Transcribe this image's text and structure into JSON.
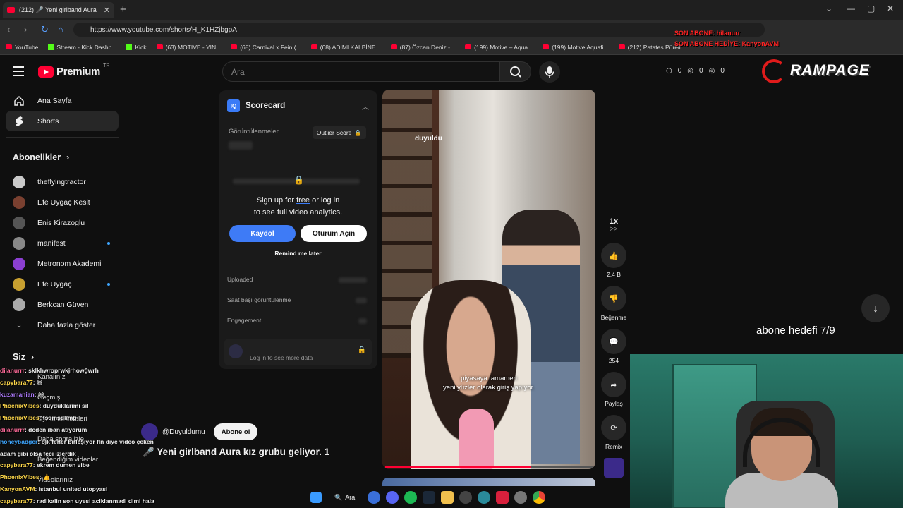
{
  "browser": {
    "tab_title": "(212) 🎤 Yeni girlband Aura",
    "tab_close": "✕",
    "new_tab": "+",
    "url": "https://www.youtube.com/shorts/H_K1HZjbgpA",
    "bookmarks": [
      "YouTube",
      "Stream - Kick Dashb...",
      "Kick",
      "(63) MOTIVE - YIN...",
      "(68) Carnival x Fein (...",
      "(68) ADIMI KALBİNE...",
      "(87) Özcan Deniz -...",
      "(199) Motive – Aqua...",
      "(199) Motive Aquafi...",
      "(212) Patates Püreli..."
    ]
  },
  "overlay": {
    "last_sub_line1": "SON ABONE: hilanurr",
    "last_sub_line2": "SON ABONE HEDİYE: KanyonAVM",
    "brand": "RAMPAGE",
    "sub_goal": "abone hedefi 7/9"
  },
  "header": {
    "logo_text": "Premium",
    "region": "TR",
    "search_placeholder": "Ara",
    "stats": [
      "0",
      "0",
      "0"
    ]
  },
  "sidebar": {
    "main": [
      {
        "label": "Ana Sayfa"
      },
      {
        "label": "Shorts"
      }
    ],
    "subs_title": "Abonelikler",
    "subs": [
      {
        "label": "theflyingtractor",
        "color": "#c9c9c9",
        "dot": false
      },
      {
        "label": "Efe Uygaç Kesit",
        "color": "#7a4030",
        "dot": false
      },
      {
        "label": "Enis Kirazoglu",
        "color": "#555555",
        "dot": false
      },
      {
        "label": "manifest",
        "color": "#888888",
        "dot": true
      },
      {
        "label": "Metronom Akademi",
        "color": "#8b3fd1",
        "dot": false
      },
      {
        "label": "Efe Uygaç",
        "color": "#c8a030",
        "dot": true
      },
      {
        "label": "Berkcan Güven",
        "color": "#aaaaaa",
        "dot": false
      }
    ],
    "more": "Daha fazla göster",
    "you_title": "Siz",
    "you_items": [
      "Kanalınız",
      "Geçmiş",
      "Oynatma listeleri",
      "Daha sonra izle",
      "Beğendiğim videolar",
      "Videolarınız"
    ]
  },
  "scorecard": {
    "title": "Scorecard",
    "iq": "IQ",
    "views_label": "Görüntülenmeler",
    "outlier": "Outlier Score",
    "signup_line1_a": "Sign up for ",
    "signup_free": "free",
    "signup_line1_b": " or log in",
    "signup_line2": "to see full video analytics.",
    "kaydol": "Kaydol",
    "oturum": "Oturum Açın",
    "remind": "Remind me later",
    "rows": [
      "Uploaded",
      "Saat başı görüntülenme",
      "Engagement"
    ],
    "login_more": "Log in to see more data"
  },
  "video": {
    "caption_line1": "piyasaya tamamen",
    "caption_line2": "yeni yüzler olarak giriş yapıyor.",
    "watermark": "duyuldu",
    "progress": 0.7,
    "channel": "@Duyuldumu",
    "subscribe": "Abone ol",
    "title": "🎤 Yeni girlband Aura kız grubu geliyor. 1"
  },
  "rail": {
    "speed": "1x",
    "likes": "2,4 B",
    "dislike": "Beğenme",
    "comments": "254",
    "share": "Paylaş",
    "remix": "Remix"
  },
  "chat": [
    {
      "user": "dilanurrr",
      "text": ": sklkhwroprwkjrhowğwrh",
      "color": "#ff6b9a"
    },
    {
      "user": "capybara77",
      "text": ": 😄",
      "color": "#ffd84a"
    },
    {
      "user": "kuzamanian",
      "text": ": 😄",
      "color": "#b07cff"
    },
    {
      "user": "PhoenixVibes",
      "text": ": duyduklarımı sil",
      "color": "#ffd84a"
    },
    {
      "user": "PhoenixVibes",
      "text": ": fşdmşdkmg",
      "color": "#ffd84a"
    },
    {
      "user": "dilanurrr",
      "text": ": dcden iban atiyorum",
      "color": "#ff6b9a"
    },
    {
      "user": "honeybadger",
      "text": ": bjk fener birleşiyor fln diye video çeken",
      "color": "#3ea6ff"
    },
    {
      "user": "",
      "text": "adam gibi olsa feci izlerdik",
      "color": "#ffffff"
    },
    {
      "user": "capybara77",
      "text": ": ekrem dumen vibe",
      "color": "#ffd84a"
    },
    {
      "user": "PhoenixVibes",
      "text": ": 👍",
      "color": "#ffd84a"
    },
    {
      "user": "KanyonAVM",
      "text": ": istanbul united utopyasi",
      "color": "#ffd84a"
    },
    {
      "user": "capybara77",
      "text": ": radikalin son uyesi aciklanmadi dimi hala",
      "color": "#ffd84a"
    }
  ],
  "taskbar": {
    "search": "Ara"
  }
}
